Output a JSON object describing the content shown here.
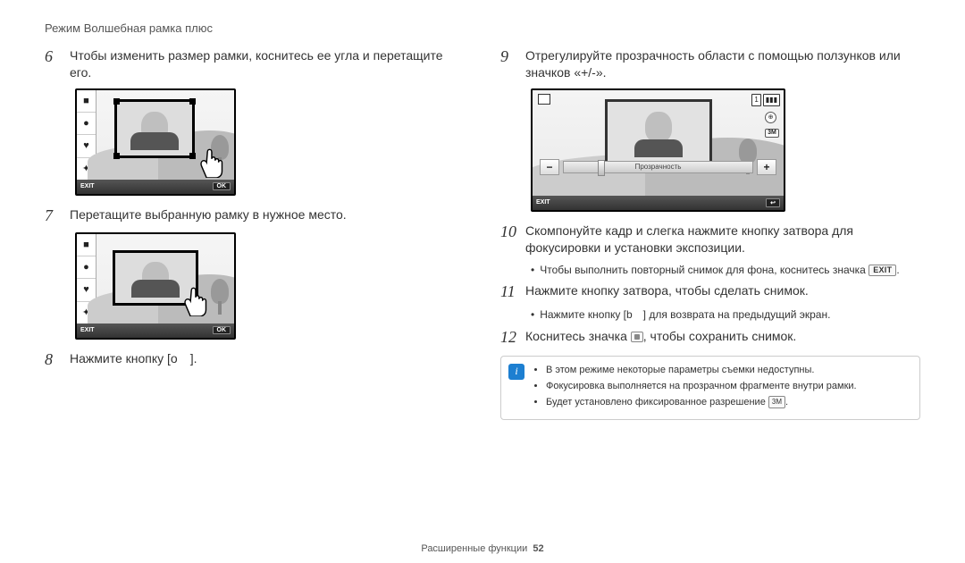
{
  "header": {
    "title": "Режим Волшебная рамка плюс"
  },
  "footer": {
    "label": "Расширенные функции",
    "page": "52"
  },
  "steps": {
    "s6": {
      "num": "6",
      "text": "Чтобы изменить размер рамки, коснитесь ее угла и перетащите его."
    },
    "s7": {
      "num": "7",
      "text": "Перетащите выбранную рамку в нужное место."
    },
    "s8": {
      "num": "8",
      "text": "Нажмите кнопку [o ]."
    },
    "s9": {
      "num": "9",
      "text": "Отрегулируйте прозрачность области с помощью ползунков или значков «+/-»."
    },
    "s10": {
      "num": "10",
      "text": "Скомпонуйте кадр и слегка нажмите кнопку затвора для фокусировки и установки экспозиции."
    },
    "s10b": "Чтобы выполнить повторный снимок для фона, коснитесь значка",
    "s10b_btn": "EXIT",
    "s11": {
      "num": "11",
      "text": "Нажмите кнопку затвора, чтобы сделать снимок."
    },
    "s11b": "Нажмите кнопку [b ] для возврата на предыдущий экран.",
    "s12": {
      "num": "12",
      "pre": "Коснитесь значка",
      "post": ", чтобы сохранить снимок."
    }
  },
  "infobox": {
    "li1": "В этом режиме некоторые параметры съемки недоступны.",
    "li2": "Фокусировка выполняется на прозрачном фрагменте внутри рамки.",
    "li3_pre": "Будет установлено фиксированное разрешение",
    "li3_box": "3M",
    "li3_post": "."
  },
  "cam_small": {
    "exit": "EXIT",
    "ok": "OK",
    "icons": [
      "■",
      "●",
      "♥",
      "✦"
    ]
  },
  "cam_wide": {
    "exit": "EXIT",
    "counter": "1",
    "slider_label": "Прозрачность",
    "minus": "−",
    "plus": "+",
    "back": "↩",
    "ri1": "⊕",
    "ri2": "3M"
  }
}
